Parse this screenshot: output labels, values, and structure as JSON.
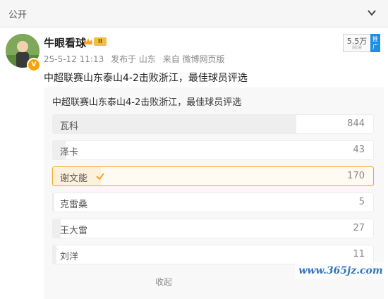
{
  "header": {
    "visibility": "公开",
    "collapse_icon": "chevron-down-icon"
  },
  "post": {
    "author": "牛眼看球",
    "level_badge": "II",
    "timestamp": "25-5-12 11:13",
    "location": "发布于 山东",
    "source": "来自 微博网页版",
    "text": "中超联赛山东泰山4-2击败浙江，最佳球员评选",
    "promo": {
      "count": "5.5万",
      "sub": "阅读",
      "button": "推广"
    }
  },
  "poll": {
    "title": "中超联赛山东泰山4-2击败浙江，最佳球员评选",
    "options": [
      {
        "label": "瓦科",
        "count": "844",
        "fraction": 0.76,
        "selected": false
      },
      {
        "label": "泽卡",
        "count": "43",
        "fraction": 0.04,
        "selected": false
      },
      {
        "label": "谢文能",
        "count": "170",
        "fraction": 0.15,
        "selected": true
      },
      {
        "label": "克雷桑",
        "count": "5",
        "fraction": 0.005,
        "selected": false
      },
      {
        "label": "王大雷",
        "count": "27",
        "fraction": 0.025,
        "selected": false
      },
      {
        "label": "刘洋",
        "count": "11",
        "fraction": 0.01,
        "selected": false
      }
    ],
    "collapse": "收起"
  },
  "watermark": "www.365jz.com",
  "colors": {
    "accent": "#f5a623",
    "promo": "#1f8fe6"
  }
}
